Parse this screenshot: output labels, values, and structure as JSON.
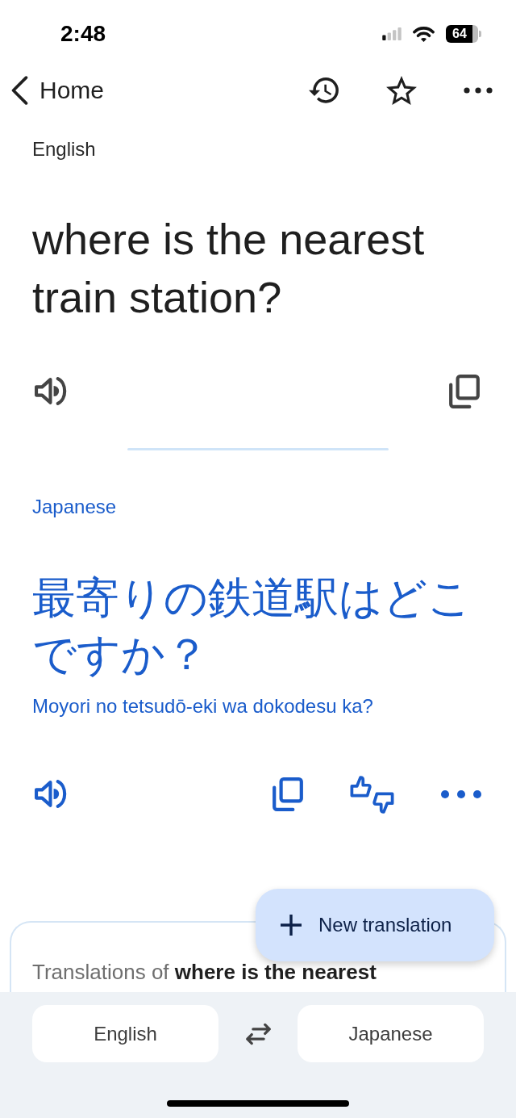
{
  "status_bar": {
    "time": "2:48",
    "battery": "64"
  },
  "nav": {
    "back_label": "Home"
  },
  "source": {
    "language": "English",
    "text": "where is the nearest train station?"
  },
  "target": {
    "language": "Japanese",
    "text": "最寄りの鉄道駅はどこですか？",
    "romanization": "Moyori no tetsudō-eki wa dokodesu ka?"
  },
  "fab": {
    "label": "New translation"
  },
  "translations_card": {
    "heading": "Translations of **where is the nearest**"
  },
  "language_bar": {
    "source": "English",
    "target": "Japanese"
  }
}
